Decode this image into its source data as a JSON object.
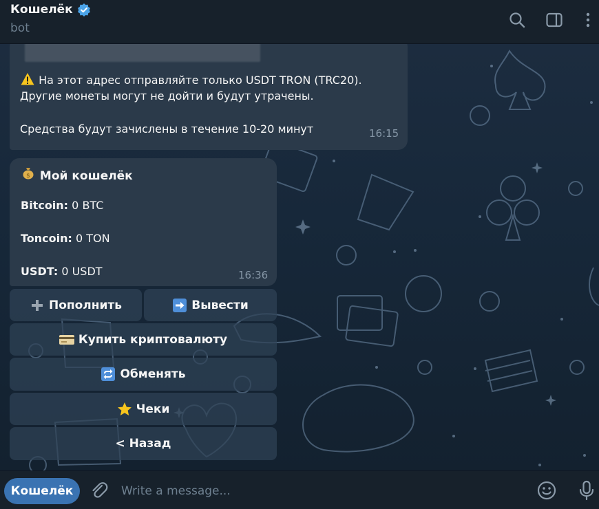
{
  "header": {
    "title": "Кошелёк",
    "subtitle": "bot"
  },
  "messages": [
    {
      "lines": [
        "⚠️ На этот адрес отправляйте только USDT TRON (TRC20).",
        "Другие монеты могут не дойти и будут утрачены.",
        "Средства будут зачислены в течение 10-20 минут"
      ],
      "warning_text": "На этот адрес отправляйте только USDT TRON (TRC20).",
      "time": "16:15"
    },
    {
      "title": "Мой кошелёк",
      "balances": [
        {
          "label": "Bitcoin:",
          "value": "0 BTC"
        },
        {
          "label": "Toncoin:",
          "value": "0 TON"
        },
        {
          "label": "USDT:",
          "value": "0 USDT"
        }
      ],
      "time": "16:36"
    }
  ],
  "keyboard": {
    "topup": "Пополнить",
    "withdraw": "Вывести",
    "buy_crypto": "Купить криптовалюту",
    "exchange": "Обменять",
    "checks": "Чеки",
    "back": "< Назад"
  },
  "composer": {
    "menu_label": "Кошелёк",
    "placeholder": "Write a message..."
  },
  "icons": {
    "verified": "verified-badge-icon",
    "search": "search-icon",
    "sidebar": "sidebar-toggle-icon",
    "more": "more-vertical-icon",
    "attach": "paperclip-icon",
    "emoji": "smile-icon",
    "mic": "microphone-icon"
  },
  "colors": {
    "accent": "#3a73b2",
    "bubble": "#2b3a4a",
    "header": "#17212b"
  }
}
